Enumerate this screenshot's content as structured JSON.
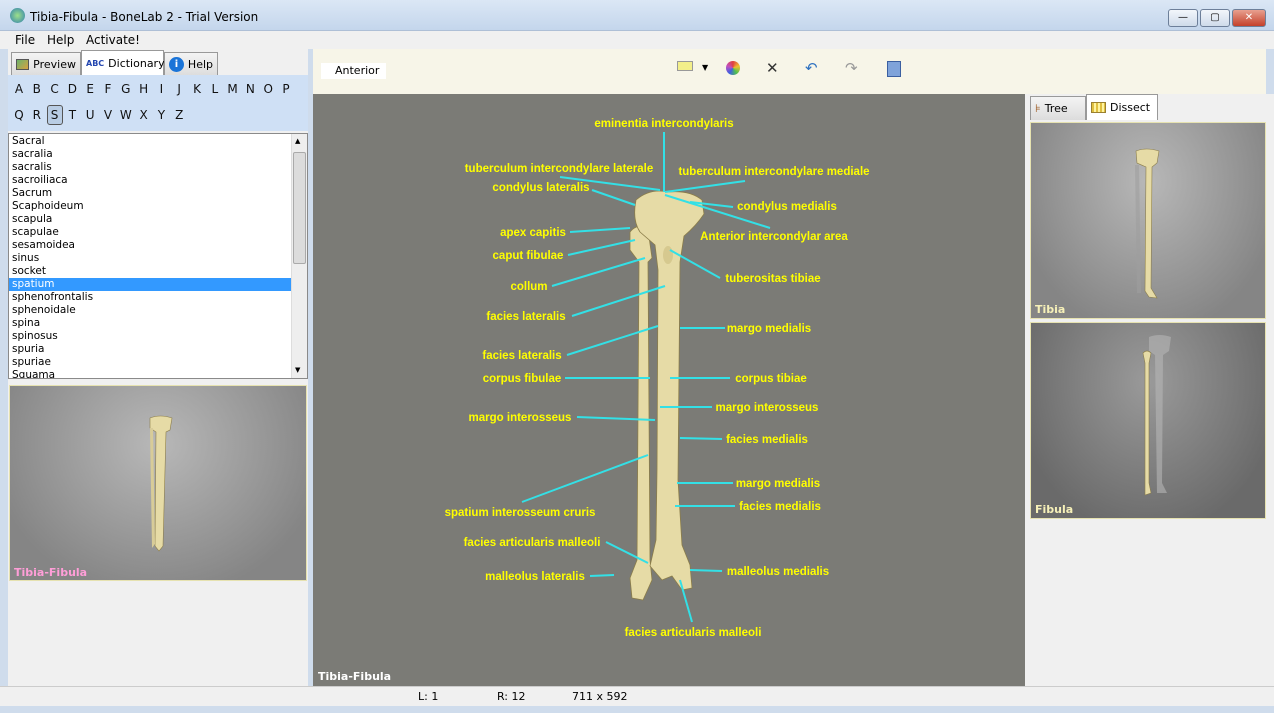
{
  "window": {
    "title": "Tibia-Fibula - BoneLab 2 - Trial Version",
    "controls": [
      "minimize",
      "maximize",
      "close"
    ]
  },
  "menu": [
    "File",
    "Help",
    "Activate!"
  ],
  "left_tabs": [
    {
      "label": "Preview",
      "icon": "preview-image-icon"
    },
    {
      "label": "Dictionary",
      "icon": "abc-icon",
      "icon_text": "ABC",
      "active": true
    },
    {
      "label": "Help",
      "icon": "info-icon"
    }
  ],
  "alphabet": [
    "A",
    "B",
    "C",
    "D",
    "E",
    "F",
    "G",
    "H",
    "I",
    "J",
    "K",
    "L",
    "M",
    "N",
    "O",
    "P",
    "Q",
    "R",
    "S",
    "T",
    "U",
    "V",
    "W",
    "X",
    "Y",
    "Z"
  ],
  "alphabet_selected": "S",
  "dictionary": [
    "Sacral",
    "sacralia",
    "sacralis",
    "sacroiliaca",
    "Sacrum",
    "Scaphoideum",
    "scapula",
    "scapulae",
    "sesamoidea",
    "sinus",
    "socket",
    "spatium",
    "sphenofrontalis",
    "sphenoidale",
    "spina",
    "spinosus",
    "spuria",
    "spuriae",
    "Squama"
  ],
  "dictionary_selected": "spatium",
  "preview_label": "Tibia-Fibula",
  "view_name": "Anterior",
  "toolbar": [
    "annotate-icon",
    "dropdown-arrow-icon",
    "color-palette-icon",
    "delete-x-icon",
    "undo-icon",
    "redo-icon",
    "save-icon"
  ],
  "viewport_label": "Tibia-Fibula",
  "labels": [
    "eminentia intercondylaris",
    "tuberculum intercondylare laterale",
    "tuberculum intercondylare mediale",
    "condylus lateralis",
    "condylus medialis",
    "Anterior intercondylar area",
    "apex capitis",
    "caput fibulae",
    "tuberositas tibiae",
    "collum",
    "facies lateralis",
    "margo medialis",
    "facies lateralis",
    "corpus fibulae",
    "corpus tibiae",
    "margo interosseus",
    "margo interosseus",
    "facies medialis",
    "margo medialis",
    "facies medialis",
    "spatium interosseum cruris",
    "facies articularis malleoli",
    "malleolus lateralis",
    "malleolus medialis",
    "facies articularis malleoli"
  ],
  "right_tabs": [
    {
      "label": "Tree",
      "icon": "tree-icon"
    },
    {
      "label": "Dissect",
      "icon": "grid-icon",
      "active": true
    }
  ],
  "parts": [
    "Tibia",
    "Fibula"
  ],
  "status": {
    "left": "L: 1",
    "right": "R: 12",
    "size": "711 x 592"
  },
  "colors": {
    "label": "#ffff00",
    "leader": "#33e0e6",
    "bone": "#e6dba6",
    "selection": "#3399ff"
  }
}
